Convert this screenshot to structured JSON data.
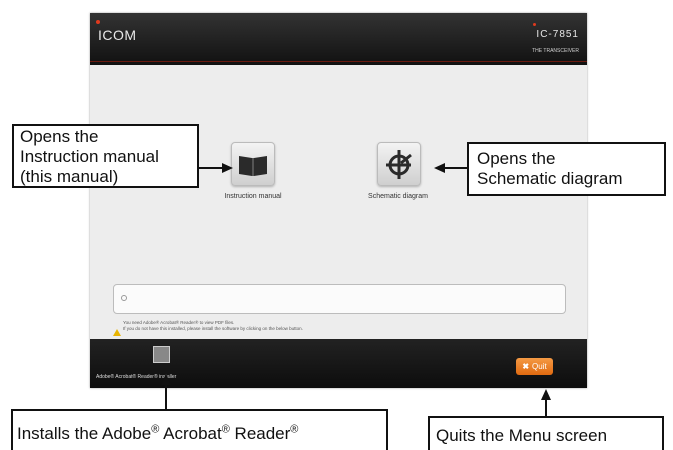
{
  "app": {
    "brand": "ICOM",
    "model": "IC-7851",
    "tagline": "THE TRANSCEIVER",
    "buttons": {
      "instruction_label": "Instruction manual",
      "schematic_label": "Schematic diagram"
    },
    "notice": {
      "line1": "You need Adobe® Acrobat® Reader® to view PDF files.",
      "line2": "If you do not have this installed, please install the software by clicking on the below button."
    },
    "footer": {
      "installer_label": "Adobe® Acrobat® Reader® installer",
      "quit_label": "Quit"
    }
  },
  "callouts": {
    "instruction": [
      "Opens the",
      "Instruction manual",
      "(this manual)"
    ],
    "schematic": [
      "Opens the",
      "Schematic diagram"
    ],
    "installer": {
      "p1": "Installs the Adobe",
      "p2": " Acrobat",
      "p3": " Reader"
    },
    "quit": "Quits the Menu screen"
  },
  "colors": {
    "accent_red": "#e03a1e",
    "quit_orange": "#f07a20",
    "bar_dark": "#111111"
  }
}
